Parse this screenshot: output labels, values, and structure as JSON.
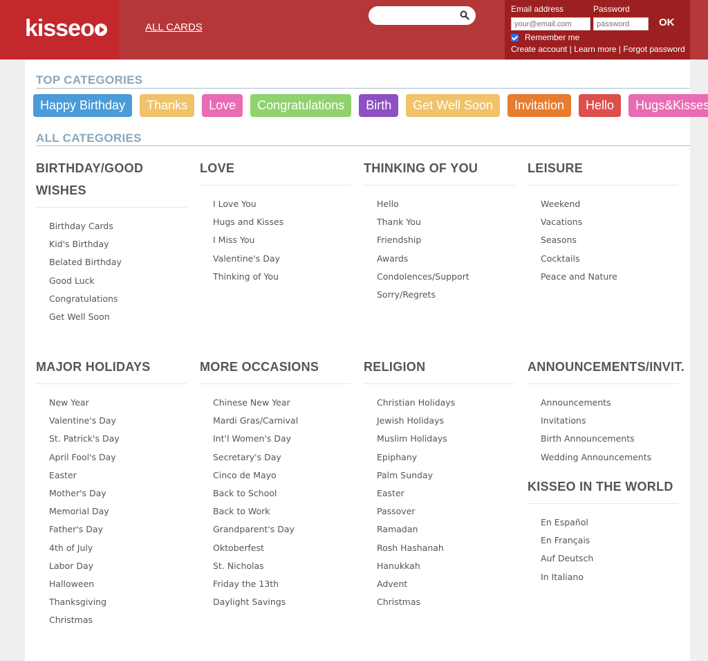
{
  "brand": {
    "logo_text": "kisseo"
  },
  "nav": {
    "all_cards": "ALL CARDS"
  },
  "search": {
    "placeholder": "",
    "value": ""
  },
  "login": {
    "email_label": "Email address",
    "password_label": "Password",
    "email_placeholder": "your@email.com",
    "password_placeholder": "password",
    "ok_label": "OK",
    "remember_label": "Remember me",
    "remember_checked": true,
    "create_account": "Create account",
    "learn_more": "Learn more",
    "forgot_password": "Forgot password",
    "separator": " | "
  },
  "top_categories": {
    "heading": "TOP CATEGORIES",
    "chips": [
      {
        "label": "Happy Birthday",
        "color": "#4a9bd9"
      },
      {
        "label": "Thanks",
        "color": "#f0c26a"
      },
      {
        "label": "Love",
        "color": "#e96bb3"
      },
      {
        "label": "Congratulations",
        "color": "#8fd26e"
      },
      {
        "label": "Birth",
        "color": "#8e4fc4"
      },
      {
        "label": "Get Well Soon",
        "color": "#f0c26a"
      },
      {
        "label": "Invitation",
        "color": "#e87c2e"
      },
      {
        "label": "Hello",
        "color": "#dc4f4b"
      },
      {
        "label": "Hugs&Kisses",
        "color": "#e96bb3"
      }
    ]
  },
  "all_categories": {
    "heading": "ALL CATEGORIES",
    "groups": [
      {
        "title": "BIRTHDAY/GOOD WISHES",
        "items": [
          "Birthday Cards",
          "Kid's Birthday",
          "Belated Birthday",
          "Good Luck",
          "Congratulations",
          "Get Well Soon"
        ]
      },
      {
        "title": "LOVE",
        "items": [
          "I Love You",
          "Hugs and Kisses",
          "I Miss You",
          "Valentine's Day",
          "Thinking of You"
        ]
      },
      {
        "title": "THINKING OF YOU",
        "items": [
          "Hello",
          "Thank You",
          "Friendship",
          "Awards",
          "Condolences/Support",
          "Sorry/Regrets"
        ]
      },
      {
        "title": "LEISURE",
        "items": [
          "Weekend",
          "Vacations",
          "Seasons",
          "Cocktails",
          "Peace and Nature"
        ]
      },
      {
        "title": "MAJOR HOLIDAYS",
        "items": [
          "New Year",
          "Valentine's Day",
          "St. Patrick's Day",
          "April Fool's Day",
          "Easter",
          "Mother's Day",
          "Memorial Day",
          "Father's Day",
          "4th of July",
          "Labor Day",
          "Halloween",
          "Thanksgiving",
          "Christmas"
        ]
      },
      {
        "title": "MORE OCCASIONS",
        "items": [
          "Chinese New Year",
          "Mardi Gras/Carnival",
          "Int'l Women's Day",
          "Secretary's Day",
          "Cinco de Mayo",
          "Back to School",
          "Back to Work",
          "Grandparent's Day",
          "Oktoberfest",
          "St. Nicholas",
          "Friday the 13th",
          "Daylight Savings"
        ]
      },
      {
        "title": "RELIGION",
        "items": [
          "Christian Holidays",
          "Jewish Holidays",
          "Muslim Holidays",
          "Epiphany",
          "Palm Sunday",
          "Easter",
          "Passover",
          "Ramadan",
          "Rosh Hashanah",
          "Hanukkah",
          "Advent",
          "Christmas"
        ]
      },
      {
        "title": "ANNOUNCEMENTS/INVIT.",
        "items": [
          "Announcements",
          "Invitations",
          "Birth Announcements",
          "Wedding Announcements"
        ]
      },
      {
        "title": "KISSEO IN THE WORLD",
        "items": [
          "En Español",
          "En Français",
          "Auf Deutsch",
          "In Italiano"
        ]
      }
    ]
  }
}
